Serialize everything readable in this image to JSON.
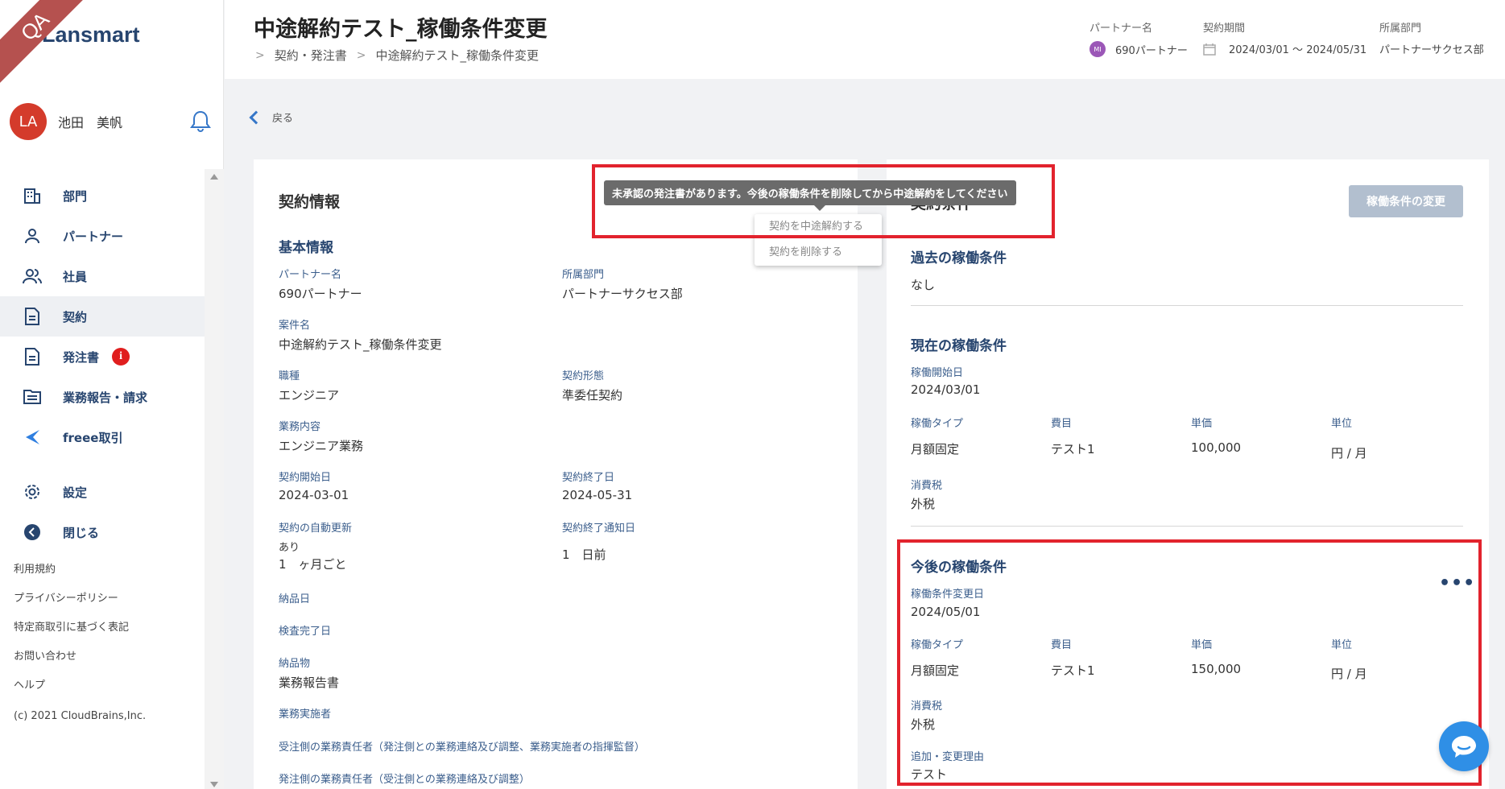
{
  "ribbon": "QA",
  "brand": {
    "name": "Lansmart"
  },
  "user": {
    "initials": "LA",
    "name": "池田　美帆"
  },
  "nav": {
    "items": [
      {
        "label": "部門"
      },
      {
        "label": "パートナー"
      },
      {
        "label": "社員"
      },
      {
        "label": "契約"
      },
      {
        "label": "発注書",
        "badge": "i"
      },
      {
        "label": "業務報告・請求"
      },
      {
        "label": "freee取引"
      }
    ],
    "settings": "設定",
    "close": "閉じる"
  },
  "footer": {
    "links": [
      "利用規約",
      "プライバシーポリシー",
      "特定商取引に基づく表記",
      "お問い合わせ",
      "ヘルプ"
    ],
    "copyright": "(c) 2021 CloudBrains,Inc."
  },
  "header": {
    "title": "中途解約テスト_稼働条件変更",
    "breadcrumb": [
      "契約・発注書",
      "中途解約テスト_稼働条件変更"
    ],
    "partner_label": "パートナー名",
    "partner_initials": "MI",
    "partner_value": "690パートナー",
    "period_label": "契約期間",
    "period_value": "2024/03/01 〜 2024/05/31",
    "dept_label": "所属部門",
    "dept_value": "パートナーサクセス部"
  },
  "back_label": "戻る",
  "contract_info": {
    "title": "契約情報",
    "section": "基本情報",
    "partner_name_label": "パートナー名",
    "partner_name": "690パートナー",
    "dept_label": "所属部門",
    "dept": "パートナーサクセス部",
    "project_label": "案件名",
    "project": "中途解約テスト_稼働条件変更",
    "job_label": "職種",
    "job": "エンジニア",
    "type_label": "契約形態",
    "type": "準委任契約",
    "work_label": "業務内容",
    "work": "エンジニア業務",
    "start_label": "契約開始日",
    "start": "2024-03-01",
    "end_label": "契約終了日",
    "end": "2024-05-31",
    "auto_renew_label": "契約の自動更新",
    "auto_renew_flag": "あり",
    "auto_renew_value": "1　ヶ月ごと",
    "notice_label": "契約終了通知日",
    "notice": "1　日前",
    "delivery_date_label": "納品日",
    "inspection_label": "検査完了日",
    "deliverable_label": "納品物",
    "deliverable": "業務報告書",
    "worker_label": "業務実施者",
    "resp_receiver_label": "受注側の業務責任者（発注側との業務連絡及び調整、業務実施者の指揮監督）",
    "resp_orderer_label": "発注側の業務責任者（受注側との業務連絡及び調整）"
  },
  "work_conditions": {
    "title": "契約条件",
    "change_button": "稼働条件の変更",
    "past_title": "過去の稼働条件",
    "past_value": "なし",
    "current": {
      "title": "現在の稼働条件",
      "start_label": "稼働開始日",
      "start": "2024/03/01",
      "type_label": "稼働タイプ",
      "type": "月額固定",
      "item_label": "費目",
      "item": "テスト1",
      "price_label": "単価",
      "price": "100,000",
      "unit_label": "単位",
      "unit": "円 / 月",
      "tax_label": "消費税",
      "tax": "外税"
    },
    "future": {
      "title": "今後の稼働条件",
      "change_date_label": "稼働条件変更日",
      "change_date": "2024/05/01",
      "type_label": "稼働タイプ",
      "type": "月額固定",
      "item_label": "費目",
      "item": "テスト1",
      "price_label": "単価",
      "price": "150,000",
      "unit_label": "単位",
      "unit": "円 / 月",
      "tax_label": "消費税",
      "tax": "外税",
      "reason_label": "追加・変更理由",
      "reason": "テスト"
    }
  },
  "tooltip": "未承認の発注書があります。今後の稼働条件を削除してから中途解約をしてください",
  "dropdown": [
    "契約を中途解約する",
    "契約を削除する"
  ],
  "colors": {
    "brand": "#27456f",
    "accent": "#3677c8",
    "highlight_border": "#e2232d",
    "avatar": "#d43b2b"
  }
}
